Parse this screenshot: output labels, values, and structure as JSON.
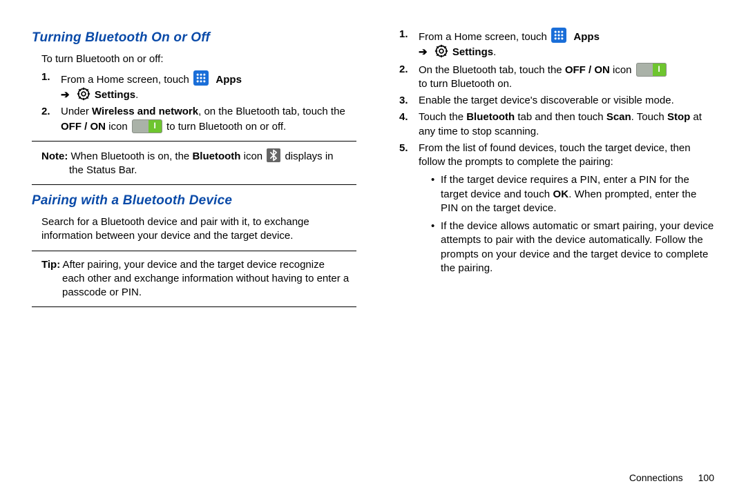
{
  "headings": {
    "h1": "Turning Bluetooth On or Off",
    "h2": "Pairing with a Bluetooth Device"
  },
  "intro": "To turn Bluetooth on or off:",
  "labels": {
    "apps": "Apps",
    "settings": "Settings",
    "arrow": "➔"
  },
  "left_list": {
    "n1": "1.",
    "i1a": "From a Home screen, touch ",
    "n2": "2.",
    "i2a": "Under ",
    "i2b": "Wireless and network",
    "i2c": ", on the Bluetooth tab, touch the ",
    "i2d": "OFF / ON",
    "i2e": " icon ",
    "i2f": " to turn Bluetooth on or off."
  },
  "note": {
    "label": "Note:",
    "a": " When Bluetooth is on, the ",
    "b": "Bluetooth",
    "c": " icon ",
    "d": " displays in the Status Bar."
  },
  "pair_intro": "Search for a Bluetooth device and pair with it, to exchange information between your device and the target device.",
  "tip": {
    "label": "Tip:",
    "a": " After pairing, your device and the target device recognize each other and exchange information without having to enter a passcode or PIN."
  },
  "right_list": {
    "n1": "1.",
    "i1a": "From a Home screen, touch ",
    "n2": "2.",
    "i2a": "On the Bluetooth tab, touch the ",
    "i2b": "OFF / ON",
    "i2c": " icon ",
    "i2d": " to turn Bluetooth on.",
    "n3": "3.",
    "i3": "Enable the target device's discoverable or visible mode.",
    "n4": "4.",
    "i4a": "Touch the ",
    "i4b": "Bluetooth",
    "i4c": " tab and then touch ",
    "i4d": "Scan",
    "i4e": ". Touch ",
    "i4f": "Stop",
    "i4g": " at any time to stop scanning.",
    "n5": "5.",
    "i5": "From the list of found devices, touch the target device, then follow the prompts to complete the pairing:"
  },
  "bullets": {
    "b1a": "If the target device requires a PIN, enter a PIN for the target device and touch ",
    "b1b": "OK",
    "b1c": ". When prompted, enter the PIN on the target device.",
    "b2": "If the device allows automatic or smart pairing, your device attempts to pair with the device automatically. Follow the prompts on your device and the target device to complete the pairing."
  },
  "footer": {
    "section": "Connections",
    "page": "100"
  }
}
